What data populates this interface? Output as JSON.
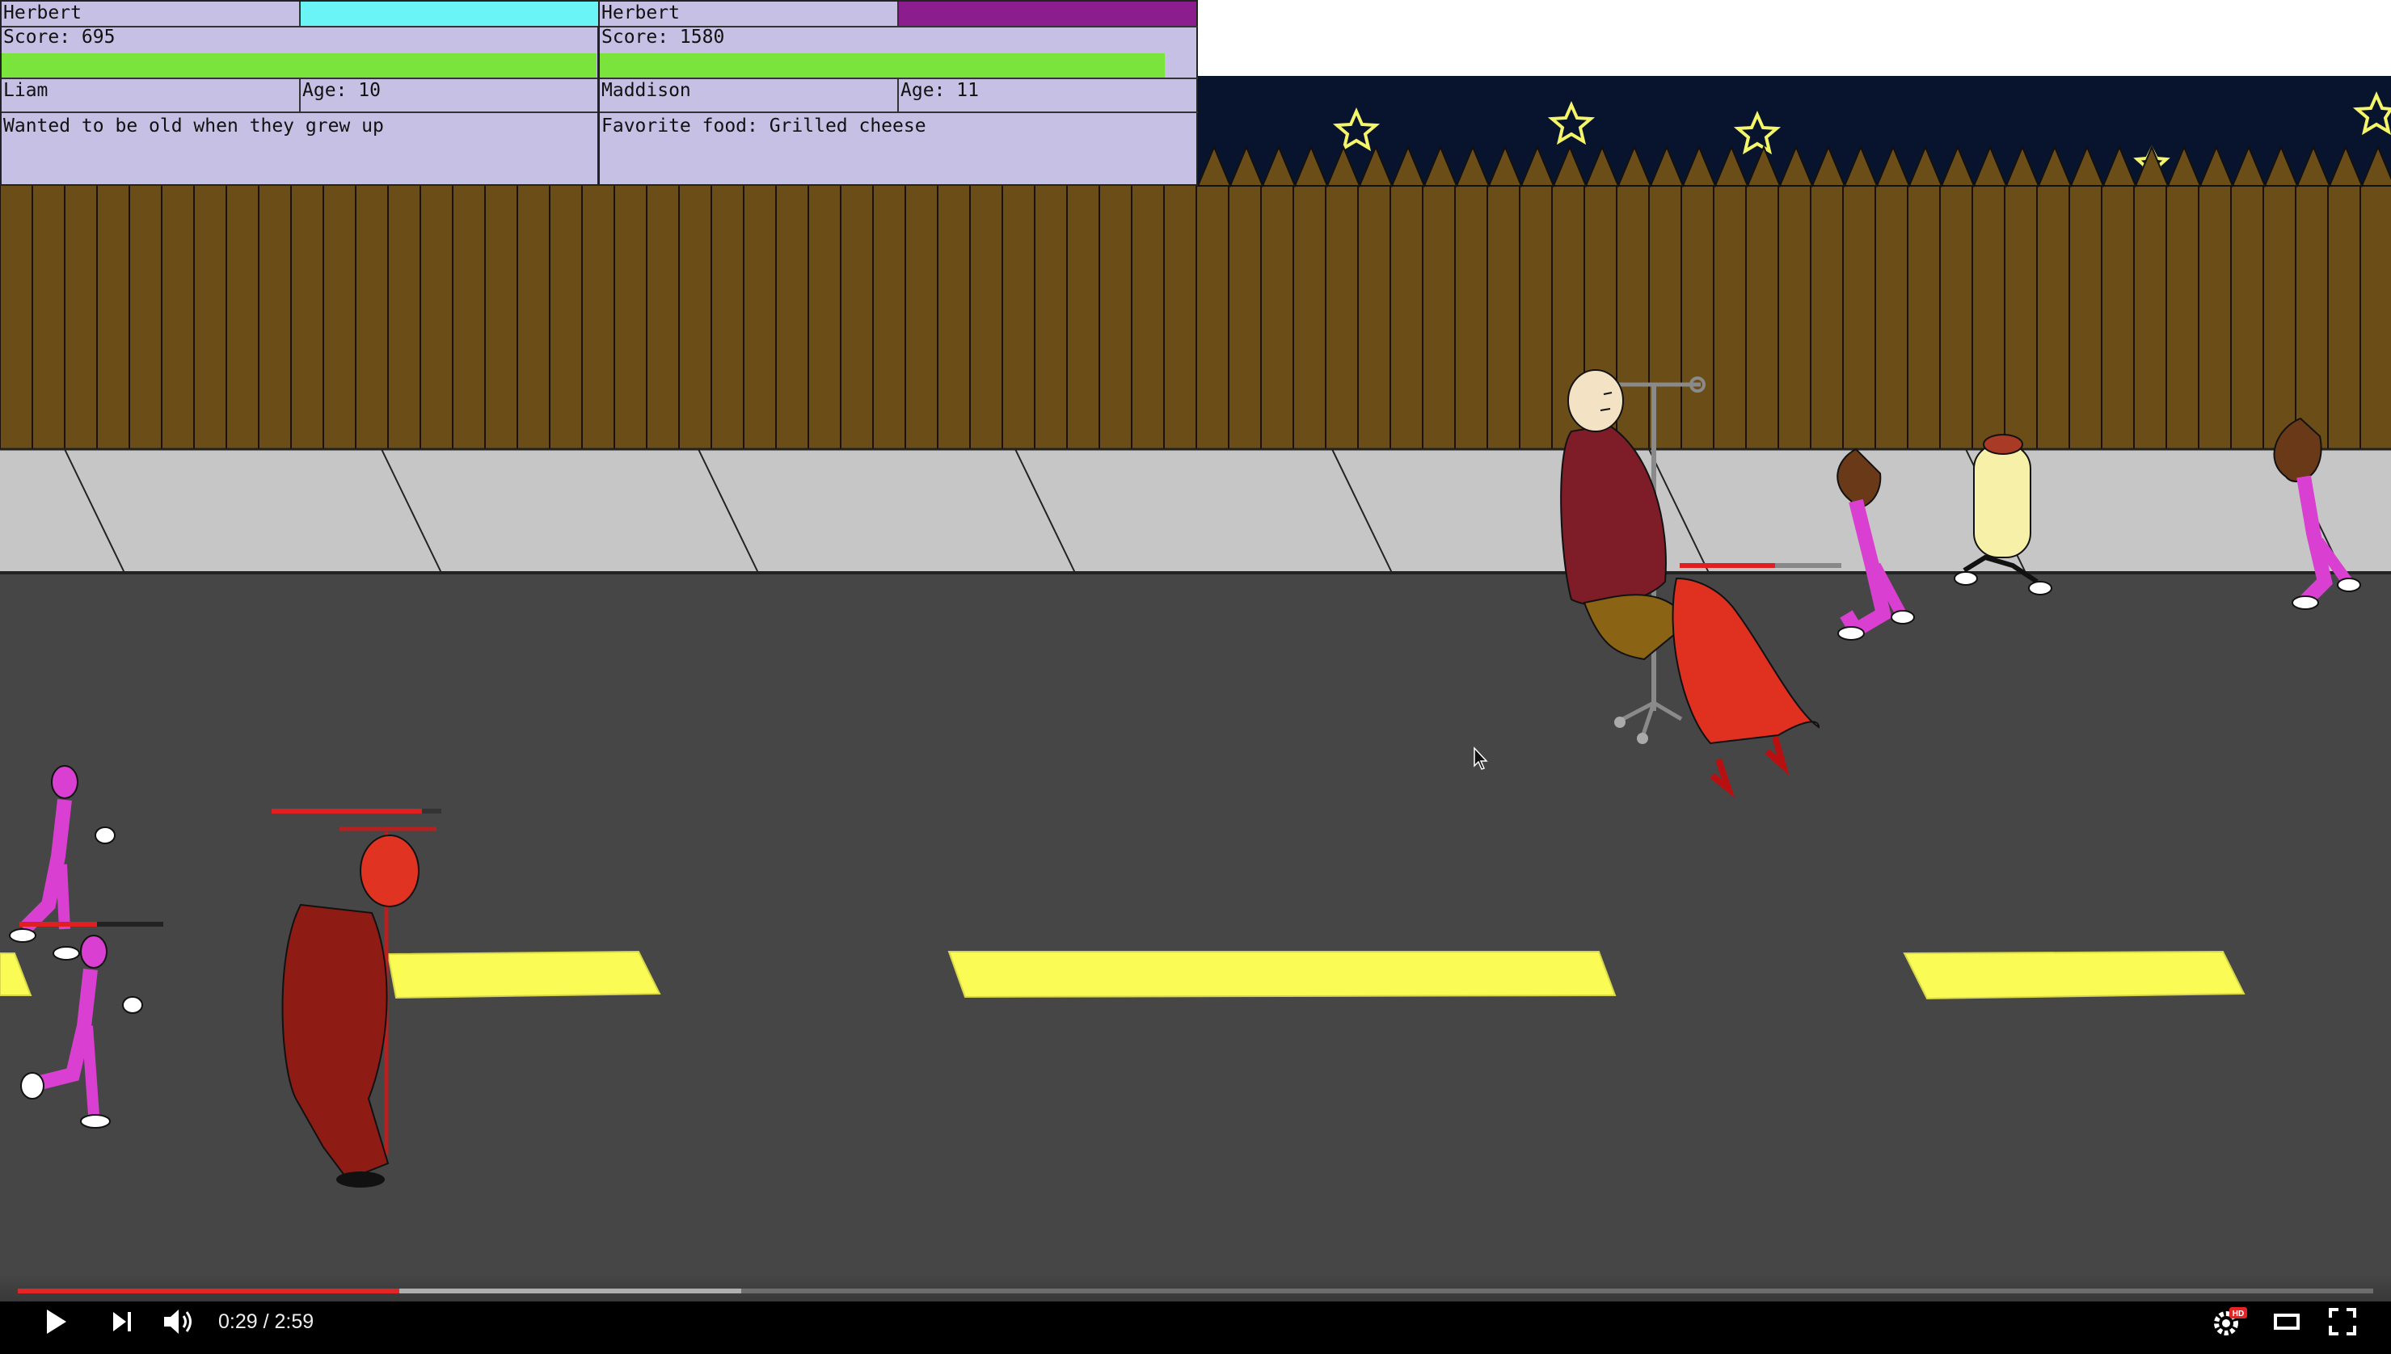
{
  "hud": {
    "left": {
      "player_name": "Herbert",
      "score_text": "Score: 695",
      "player_color": "#6bf4f5",
      "health_fraction": 1.0,
      "character_name": "Liam",
      "age_text": "Age: 10",
      "fact_text": "Wanted to be old when they grew up"
    },
    "right": {
      "player_name": "Herbert",
      "score_text": "Score: 1580",
      "player_color": "#8c1d8e",
      "health_fraction": 0.95,
      "character_name": "Maddison",
      "age_text": "Age: 11",
      "fact_text": "Favorite food: Grilled cheese"
    }
  },
  "video": {
    "time_text": "0:29 / 2:59",
    "played_fraction": 0.162,
    "buffered_fraction": 0.307,
    "accent_color": "#e52525",
    "hd_badge": "HD",
    "icons": [
      "play-icon",
      "next-icon",
      "volume-icon",
      "settings-icon",
      "theater-mode-icon",
      "fullscreen-icon"
    ]
  },
  "colors": {
    "sky": "#08142e",
    "fence": "#6b4d17",
    "sidewalk": "#c6c6c6",
    "road": "#464646",
    "lane_marking": "#fbfb56",
    "hud_background": "#c6c0e4",
    "health_bar": "#7ae43c"
  }
}
